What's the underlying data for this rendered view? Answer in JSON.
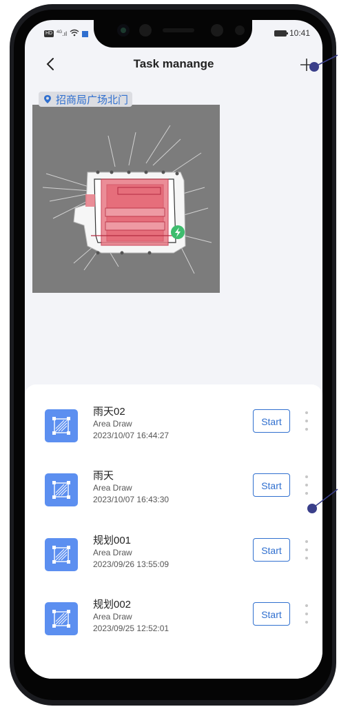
{
  "status_bar": {
    "hd": "HD",
    "network": "4G",
    "time": "10:41"
  },
  "header": {
    "title": "Task manange"
  },
  "location": {
    "name": "招商局广场北门"
  },
  "tasks": [
    {
      "name": "雨天02",
      "type": "Area Draw",
      "date": "2023/10/07 16:44:27",
      "start_label": "Start"
    },
    {
      "name": "雨天",
      "type": "Area Draw",
      "date": "2023/10/07 16:43:30",
      "start_label": "Start"
    },
    {
      "name": "规划001",
      "type": "Area Draw",
      "date": "2023/09/26 13:55:09",
      "start_label": "Start"
    },
    {
      "name": "规划002",
      "type": "Area Draw",
      "date": "2023/09/25 12:52:01",
      "start_label": "Start"
    }
  ],
  "colors": {
    "accent": "#2f6fcf",
    "task_icon": "#5c8ff0",
    "area_fill": "#e87a86",
    "area_border": "#c83c50",
    "charger": "#3ebd6e",
    "pointer": "#3a3f8a"
  }
}
